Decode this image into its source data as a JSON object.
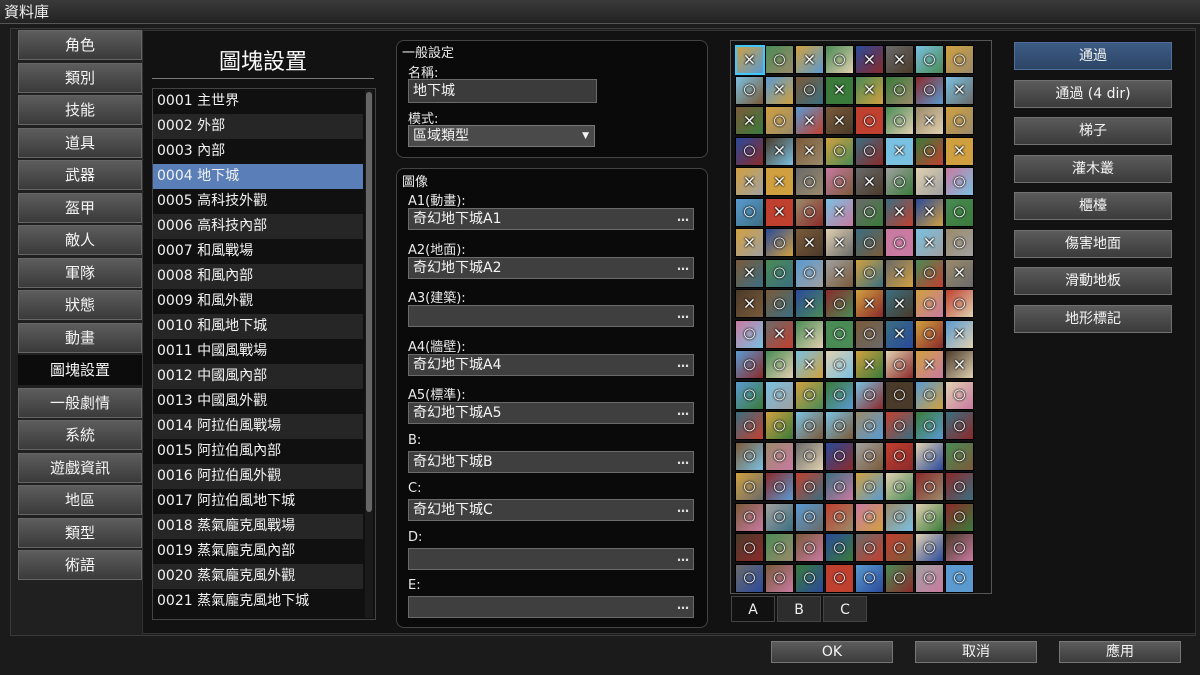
{
  "window": {
    "title": "資料庫"
  },
  "categories": [
    {
      "label": "角色"
    },
    {
      "label": "類別"
    },
    {
      "label": "技能"
    },
    {
      "label": "道具"
    },
    {
      "label": "武器"
    },
    {
      "label": "盔甲"
    },
    {
      "label": "敵人"
    },
    {
      "label": "軍隊"
    },
    {
      "label": "狀態"
    },
    {
      "label": "動畫"
    },
    {
      "label": "圖塊設置",
      "active": true
    },
    {
      "label": "一般劇情"
    },
    {
      "label": "系統"
    },
    {
      "label": "遊戲資訊"
    },
    {
      "label": "地區"
    },
    {
      "label": "類型"
    },
    {
      "label": "術語"
    }
  ],
  "tileset_list": {
    "title": "圖塊設置",
    "items": [
      "0001 主世界",
      "0002 外部",
      "0003 內部",
      "0004 地下城",
      "0005 高科技外觀",
      "0006 高科技內部",
      "0007 和風戰場",
      "0008 和風內部",
      "0009 和風外觀",
      "0010 和風地下城",
      "0011 中國風戰場",
      "0012 中國風內部",
      "0013 中國風外觀",
      "0014 阿拉伯風戰場",
      "0015 阿拉伯風內部",
      "0016 阿拉伯風外觀",
      "0017 阿拉伯風地下城",
      "0018 蒸氣龐克風戰場",
      "0019 蒸氣龐克風內部",
      "0020 蒸氣龐克風外觀",
      "0021 蒸氣龐克風地下城"
    ],
    "selected_index": 3
  },
  "general": {
    "group_label": "一般設定",
    "name_label": "名稱:",
    "name_value": "地下城",
    "mode_label": "模式:",
    "mode_value": "區域類型"
  },
  "images": {
    "group_label": "圖像",
    "fields": [
      {
        "label": "A1(動畫):",
        "value": "奇幻地下城A1"
      },
      {
        "label": "A2(地面):",
        "value": "奇幻地下城A2"
      },
      {
        "label": "A3(建築):",
        "value": ""
      },
      {
        "label": "A4(牆壁):",
        "value": "奇幻地下城A4"
      },
      {
        "label": "A5(標準):",
        "value": "奇幻地下城A5"
      },
      {
        "label": "B:",
        "value": "奇幻地下城B"
      },
      {
        "label": "C:",
        "value": "奇幻地下城C"
      },
      {
        "label": "D:",
        "value": ""
      },
      {
        "label": "E:",
        "value": ""
      }
    ],
    "browse_glyph": "…"
  },
  "viewer": {
    "tabs": [
      "A",
      "B",
      "C"
    ],
    "active_tab": "A"
  },
  "modes": [
    {
      "label": "通過",
      "active": true
    },
    {
      "label": "通過 (4 dir)"
    },
    {
      "label": "梯子"
    },
    {
      "label": "灌木叢"
    },
    {
      "label": "櫃檯"
    },
    {
      "label": "傷害地面"
    },
    {
      "label": "滑動地板"
    },
    {
      "label": "地形標記"
    }
  ],
  "footer": {
    "ok": "OK",
    "cancel": "取消",
    "apply": "應用"
  },
  "colors": {
    "accent": "#5a7fb8",
    "selected_mode": "#2c4566",
    "selection_outline": "#3fc8ff"
  }
}
